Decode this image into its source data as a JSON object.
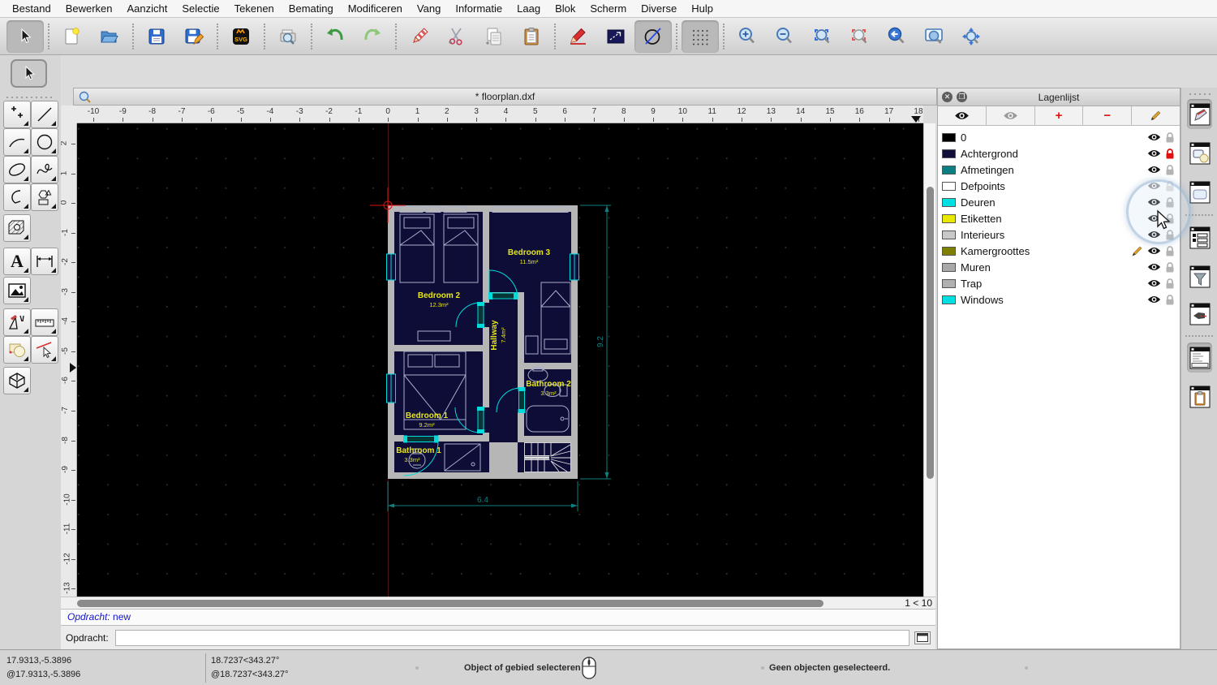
{
  "menu": {
    "items": [
      "Bestand",
      "Bewerken",
      "Aanzicht",
      "Selectie",
      "Tekenen",
      "Bemating",
      "Modificeren",
      "Vang",
      "Informatie",
      "Laag",
      "Blok",
      "Scherm",
      "Diverse",
      "Hulp"
    ]
  },
  "toolbar": {
    "buttons": [
      "select",
      "new-document",
      "open-file",
      "save",
      "save-as",
      "export-svg",
      "print-preview",
      "undo",
      "redo",
      "delete",
      "cut",
      "copy",
      "paste",
      "pen",
      "line-attributes",
      "draft-mode",
      "grid-toggle",
      "zoom-in",
      "zoom-out",
      "zoom-auto",
      "zoom-previous",
      "zoom-back",
      "zoom-window",
      "zoom-pan"
    ]
  },
  "left_toolbar": {
    "tools": [
      "select",
      "points",
      "line",
      "arc",
      "circle",
      "ellipse",
      "spline",
      "polyline",
      "polygon",
      "hatch",
      "text",
      "dimension",
      "image",
      "modify",
      "measure",
      "order",
      "select-entity",
      "solid"
    ]
  },
  "document": {
    "title": "* floorplan.dxf",
    "zoom_indicator": "1 < 10"
  },
  "rulers": {
    "horizontal": [
      "-10",
      "-9",
      "-8",
      "-7",
      "-6",
      "-5",
      "-4",
      "-3",
      "-2",
      "-1",
      "0",
      "1",
      "2",
      "3",
      "4",
      "5",
      "6",
      "7",
      "8",
      "9",
      "10",
      "11",
      "12",
      "13",
      "14",
      "15",
      "16",
      "17",
      "18"
    ],
    "vertical": [
      "2",
      "1",
      "0",
      "-1",
      "-2",
      "-3",
      "-4",
      "-5",
      "-6",
      "-7",
      "-8",
      "-9",
      "-10",
      "-11",
      "-12",
      "-13"
    ]
  },
  "floorplan": {
    "rooms": [
      {
        "name": "Bedroom 2",
        "area": "12.3m²"
      },
      {
        "name": "Bedroom 3",
        "area": "11.5m²"
      },
      {
        "name": "Hallway",
        "area": "7.4m²"
      },
      {
        "name": "Bedroom 1",
        "area": "9.2m²"
      },
      {
        "name": "Bathroom 1",
        "area": "3.3m²"
      },
      {
        "name": "Bathroom 2",
        "area": "3.3m²"
      }
    ],
    "dimensions": {
      "width": "6.4",
      "height": "9.2"
    },
    "colors": {
      "walls": "#b6b6b6",
      "rooms": "#0d0d38",
      "doors": "#00dcdc",
      "labels": "#e8e814",
      "dimension_lines": "#0c8080",
      "origin_marker": "#ff0000"
    }
  },
  "layer_panel": {
    "title": "Lagenlijst",
    "tools": [
      "show-all-layers",
      "hide-all-layers",
      "add-layer",
      "remove-layer",
      "edit-layer"
    ],
    "tool_glyphs": {
      "add": "+",
      "remove": "−"
    },
    "layers": [
      {
        "name": "0",
        "color": "#000000",
        "visible": true,
        "locked": false,
        "current": false,
        "dimmed": false
      },
      {
        "name": "Achtergrond",
        "color": "#10103a",
        "visible": true,
        "locked": true,
        "current": false,
        "dimmed": false
      },
      {
        "name": "Afmetingen",
        "color": "#0c8080",
        "visible": true,
        "locked": false,
        "current": false,
        "dimmed": false
      },
      {
        "name": "Defpoints",
        "color": "#ffffff",
        "visible": true,
        "locked": false,
        "current": false,
        "dimmed": true
      },
      {
        "name": "Deuren",
        "color": "#00e0e0",
        "visible": true,
        "locked": false,
        "current": false,
        "dimmed": false
      },
      {
        "name": "Etiketten",
        "color": "#e8e800",
        "visible": true,
        "locked": false,
        "current": false,
        "dimmed": false
      },
      {
        "name": "Interieurs",
        "color": "#c8c8c8",
        "visible": true,
        "locked": false,
        "current": false,
        "dimmed": false
      },
      {
        "name": "Kamergroottes",
        "color": "#7f7f00",
        "visible": true,
        "locked": false,
        "current": true,
        "dimmed": false
      },
      {
        "name": "Muren",
        "color": "#a8a8a8",
        "visible": true,
        "locked": false,
        "current": false,
        "dimmed": false
      },
      {
        "name": "Trap",
        "color": "#b0b0b0",
        "visible": true,
        "locked": false,
        "current": false,
        "dimmed": false
      },
      {
        "name": "Windows",
        "color": "#00e0e0",
        "visible": true,
        "locked": false,
        "current": false,
        "dimmed": false
      }
    ]
  },
  "command": {
    "history_label": "Opdracht:",
    "history_value": "new",
    "prompt_label": "Opdracht:",
    "input_value": ""
  },
  "status_bar": {
    "abs_coords": "17.9313,-5.3896",
    "rel_coords": "@17.9313,-5.3896",
    "abs_polar": "18.7237<343.27°",
    "rel_polar": "@18.7237<343.27°",
    "hint": "Object of gebied selecteren",
    "selection_status": "Geen objecten geselecteerd."
  }
}
